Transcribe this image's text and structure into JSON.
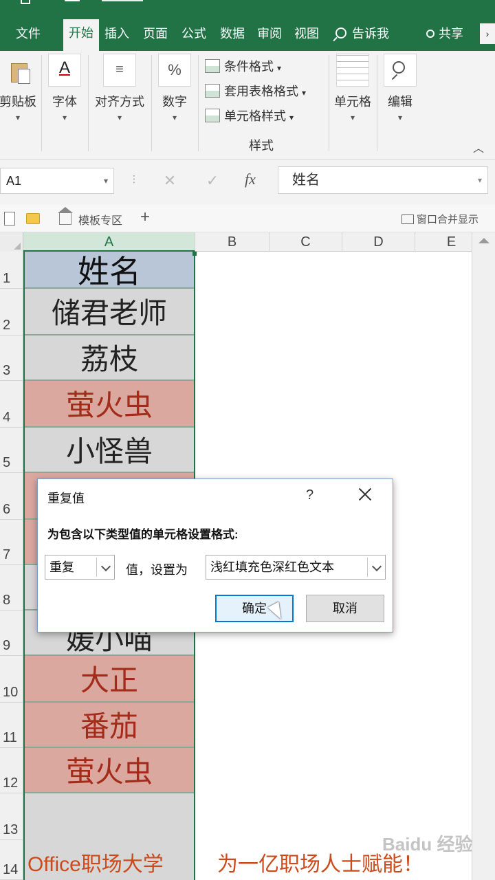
{
  "ribbon": {
    "tabs": [
      "文件",
      "开始",
      "插入",
      "页面",
      "公式",
      "数据",
      "审阅",
      "视图"
    ],
    "active_tab": "开始",
    "search_label": "告诉我",
    "share_label": "共享",
    "groups": {
      "clipboard": "剪贴板",
      "font": "字体",
      "alignment": "对齐方式",
      "number": "数字",
      "cells": "单元格",
      "editing": "编辑"
    },
    "styles": {
      "conditional": "条件格式",
      "table_format": "套用表格格式",
      "cell_styles": "单元格样式",
      "caption": "样式"
    },
    "number_icon": "%"
  },
  "formula_bar": {
    "name_box": "A1",
    "fx_label": "fx",
    "content": "姓名"
  },
  "workbook_bar": {
    "template_tab": "模板专区",
    "plus": "+",
    "merge_label": "窗口合并显示"
  },
  "grid": {
    "columns": [
      "A",
      "B",
      "C",
      "D",
      "E"
    ],
    "rows": [
      "1",
      "2",
      "3",
      "4",
      "5",
      "6",
      "7",
      "8",
      "9",
      "10",
      "11",
      "12",
      "13",
      "14"
    ],
    "cells": [
      {
        "row": 1,
        "value": "姓名",
        "style": "header"
      },
      {
        "row": 2,
        "value": "储君老师",
        "style": "normal"
      },
      {
        "row": 3,
        "value": "荔枝",
        "style": "normal"
      },
      {
        "row": 4,
        "value": "萤火虫",
        "style": "duplicate"
      },
      {
        "row": 5,
        "value": "小怪兽",
        "style": "normal"
      },
      {
        "row": 9,
        "value": "媛小喵",
        "style": "normal"
      },
      {
        "row": 10,
        "value": "大正",
        "style": "duplicate"
      },
      {
        "row": 11,
        "value": "番茄",
        "style": "duplicate"
      },
      {
        "row": 12,
        "value": "萤火虫",
        "style": "duplicate"
      }
    ],
    "selected_column": "A"
  },
  "dialog": {
    "title": "重复值",
    "help": "?",
    "instruction": "为包含以下类型值的单元格设置格式:",
    "type_value": "重复",
    "middle_text": "值，设置为",
    "format_value": "浅红填充色深红色文本",
    "ok_label": "确定",
    "cancel_label": "取消"
  },
  "watermark": {
    "left_text": "Office职场大学",
    "right_text": "为一亿职场人士赋能！",
    "logo_text": "Baidu 经验"
  },
  "colors": {
    "excel_green": "#217346",
    "header_fill": "#b9c6d8",
    "duplicate_fill": "#dba8a0",
    "duplicate_text": "#a32b1a",
    "watermark": "#cc4a1a"
  }
}
